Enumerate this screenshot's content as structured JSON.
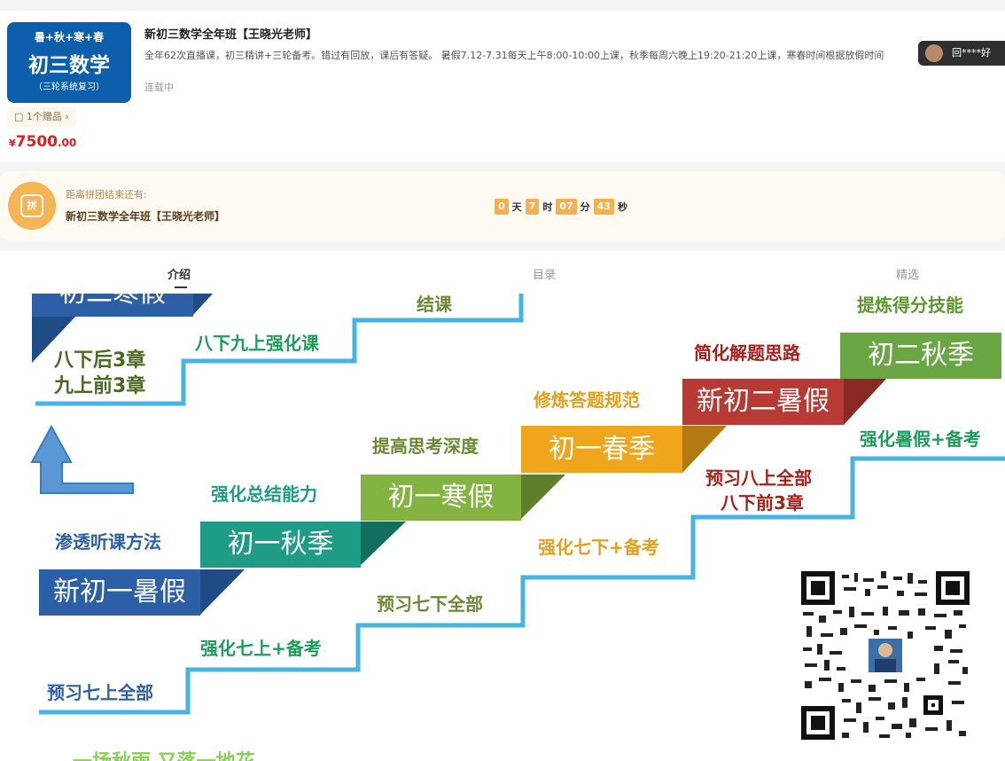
{
  "course": {
    "cover": {
      "top": "暑+秋+寒+春",
      "mid": "初三数学",
      "bot": "（三轮系统复习）"
    },
    "title": "新初三数学全年班【王晓光老师】",
    "desc": "全年62次直播课，初三精讲+三轮备考。错过有回放，课后有答疑。 暑假7.12-7.31每天上午8:00-10:00上课，秋季每周六晚上19:20-21:20上课，寒春时间根据放假时间",
    "status": "连载中",
    "gift": "1个赠品",
    "price_cur": "¥",
    "price_num": "7500",
    "price_dec": ".00"
  },
  "viewer": {
    "name": "回****好"
  },
  "group": {
    "icon_label": "拼",
    "label": "距离拼团结束还有:",
    "name": "新初三数学全年班【王晓光老师】",
    "countdown": {
      "days": "0",
      "day_unit": "天",
      "hours": "7",
      "hour_unit": "时",
      "minutes": "07",
      "minute_unit": "分",
      "seconds": "43",
      "second_unit": "秒"
    }
  },
  "tabs": [
    {
      "label": "介绍",
      "active": true
    },
    {
      "label": "目录",
      "active": false
    },
    {
      "label": "精选",
      "active": false
    }
  ],
  "poster": {
    "boxes": {
      "b1": "新初一暑假",
      "b2": "初一秋季",
      "b3": "初一寒假",
      "b4": "初一春季",
      "b5": "新初二暑假",
      "b6": "初二秋季",
      "b_top": "初二寒假"
    },
    "labels": {
      "l1": "渗透听课方法",
      "l2": "强化总结能力",
      "l3": "提高思考深度",
      "l4": "修炼答题规范",
      "l5": "简化解题思路",
      "l6": "提炼得分技能",
      "l7": "预习七上全部",
      "l8": "强化七上+备考",
      "l9": "预习七下全部",
      "l10": "强化七下+备考",
      "l11a": "预习八上全部",
      "l11b": "八下前3章",
      "l12": "强化暑假+备考",
      "l13": "八下九上强化课",
      "l14a": "八下后3章",
      "l14b": "九上前3章",
      "l15": "结课",
      "l16": "一场秋雨 又落一地花"
    },
    "colors": {
      "blue": "#2c5fa6",
      "teal": "#1e9c86",
      "green": "#83b340",
      "orange": "#efa51c",
      "red": "#b83a34",
      "green2": "#6aa643",
      "line": "#46b3e0"
    }
  }
}
